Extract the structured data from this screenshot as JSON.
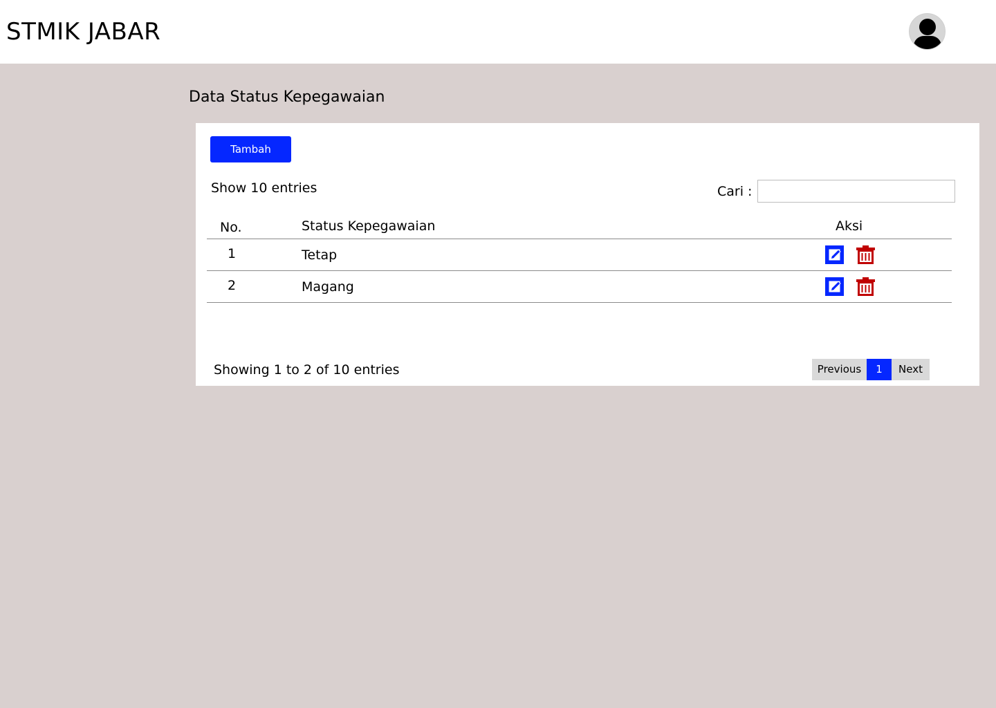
{
  "header": {
    "brand": "STMIK JABAR",
    "avatar_icon": "user-avatar-icon"
  },
  "page": {
    "title": "Data Status Kepegawaian"
  },
  "toolbar": {
    "add_label": "Tambah",
    "show_entries": "Show 10 entries",
    "search_label": "Cari :",
    "search_value": ""
  },
  "table": {
    "headers": {
      "no": "No.",
      "status": "Status Kepegawaian",
      "aksi": "Aksi"
    },
    "rows": [
      {
        "no": "1",
        "status": "Tetap"
      },
      {
        "no": "2",
        "status": "Magang"
      }
    ],
    "action_icons": [
      "edit-icon",
      "delete-icon"
    ]
  },
  "footer": {
    "info": "Showing 1 to 2 of 10 entries",
    "prev_label": "Previous",
    "current_page": "1",
    "next_label": "Next"
  },
  "colors": {
    "primary": "#0527ff",
    "danger": "#c00000",
    "background": "#d9d0cf"
  }
}
